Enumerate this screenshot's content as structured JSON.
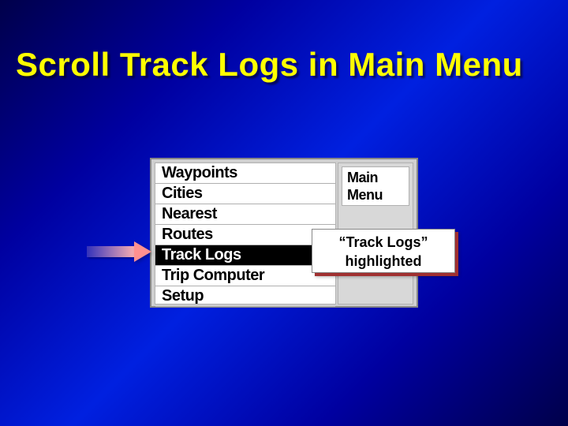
{
  "title": "Scroll Track Logs in Main Menu",
  "menu": {
    "items": [
      "Waypoints",
      "Cities",
      "Nearest",
      "Routes",
      "Track Logs",
      "Trip Computer",
      "Setup"
    ],
    "selected_index": 4,
    "side_label_line1": "Main",
    "side_label_line2": "Menu"
  },
  "callout": {
    "line1": "“Track Logs”",
    "line2": "highlighted"
  }
}
